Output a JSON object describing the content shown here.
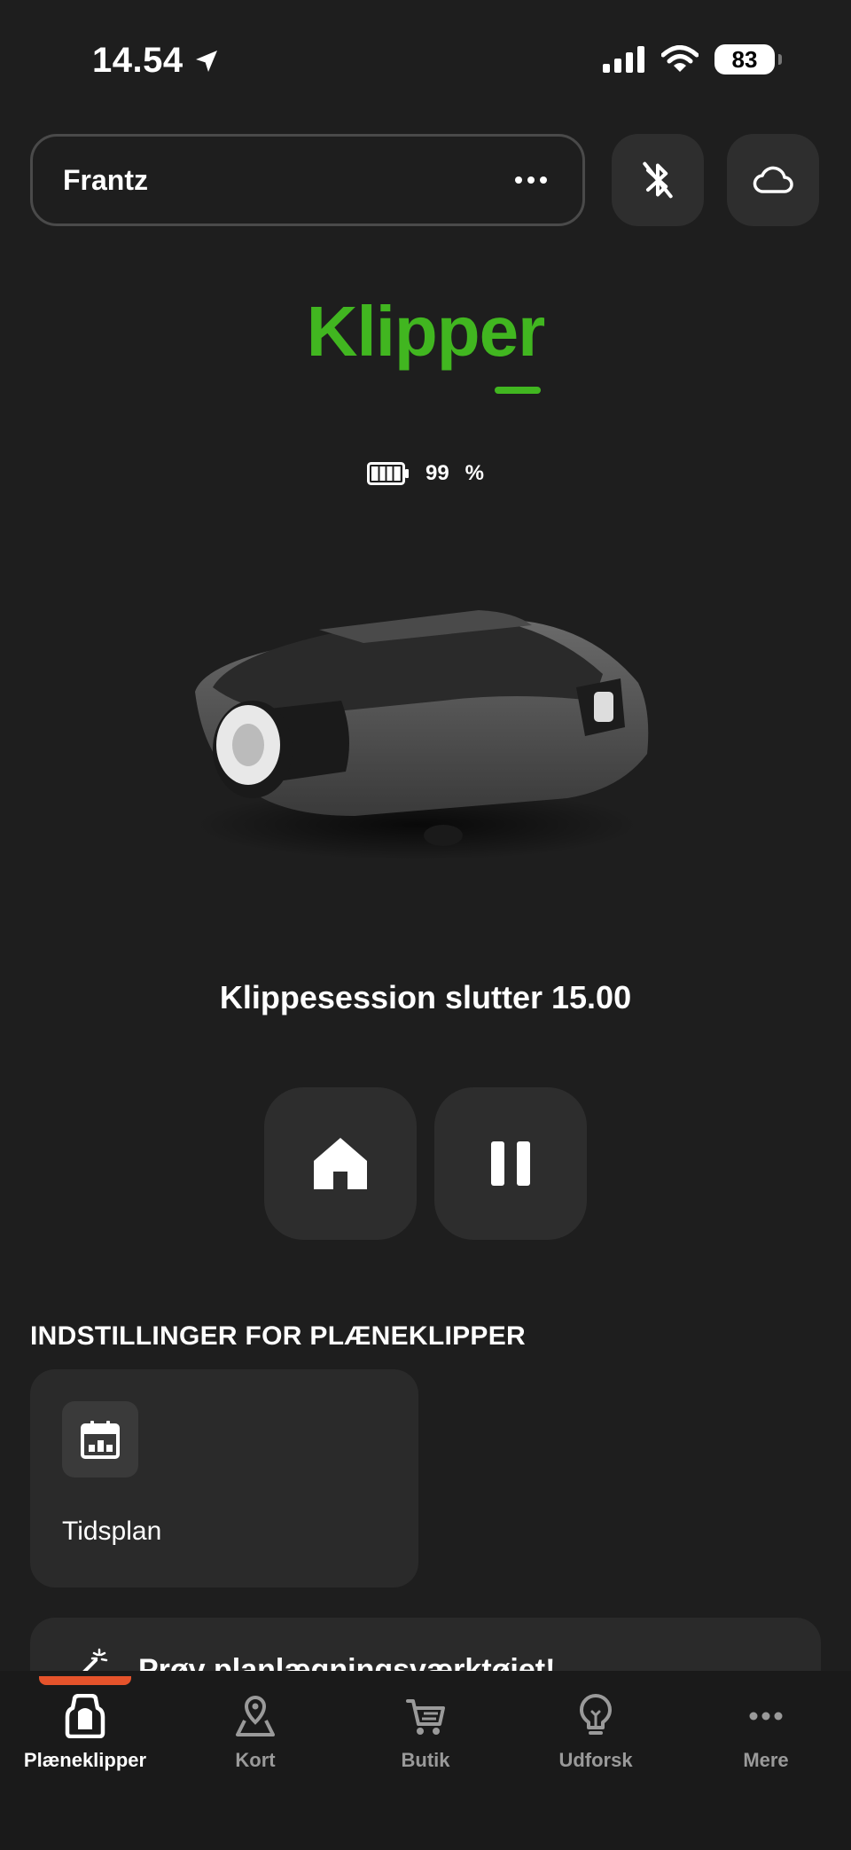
{
  "status_bar": {
    "time": "14.54",
    "battery": "83"
  },
  "header": {
    "mower_name": "Frantz"
  },
  "mower_status": {
    "state": "Klipper",
    "battery_value": "99",
    "battery_unit": "%",
    "battery_level": 0.99
  },
  "session": {
    "text": "Klippesession slutter 15.00"
  },
  "settings": {
    "title": "INDSTILLINGER FOR PLÆNEKLIPPER",
    "cards": [
      {
        "label": "Tidsplan",
        "icon": "calendar-icon"
      }
    ]
  },
  "promo": {
    "text": "Prøv planlægningsværktøjet!"
  },
  "nav": {
    "items": [
      {
        "label": "Plæneklipper",
        "icon": "mower-icon",
        "active": true
      },
      {
        "label": "Kort",
        "icon": "map-pin-icon"
      },
      {
        "label": "Butik",
        "icon": "cart-icon"
      },
      {
        "label": "Udforsk",
        "icon": "lightbulb-icon"
      },
      {
        "label": "Mere",
        "icon": "more-icon"
      }
    ]
  },
  "colors": {
    "accent": "#41b620",
    "background": "#1e1e1e",
    "nav_indicator": "#e5532b"
  }
}
